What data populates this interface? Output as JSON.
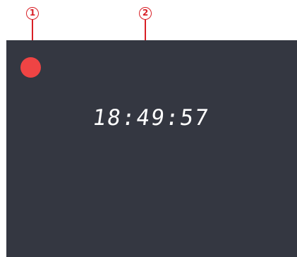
{
  "annotations": {
    "callout_1": "1",
    "callout_2": "2"
  },
  "recorder": {
    "record_indicator": "record-dot",
    "accent_color": "#ef4444",
    "background_color": "#343741",
    "clock_time": "18:49:57"
  }
}
